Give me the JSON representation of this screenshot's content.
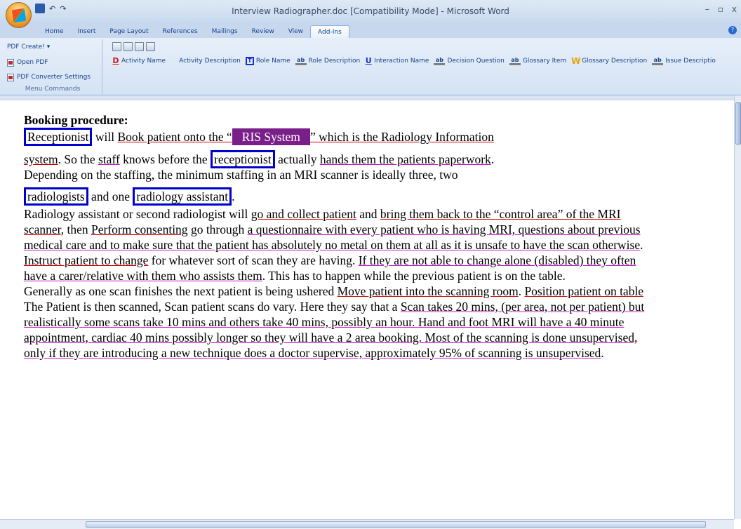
{
  "window": {
    "title": "Interview Radiographer.doc [Compatibility Mode] - Microsoft Word",
    "minimize": "–",
    "restore": "▫",
    "close": "x",
    "undo_glyph": "↶",
    "redo_glyph": "↷"
  },
  "tabs": [
    "Home",
    "Insert",
    "Page Layout",
    "References",
    "Mailings",
    "Review",
    "View",
    "Add-Ins"
  ],
  "active_tab": "Add-Ins",
  "menu_commands": {
    "pdf_create": "PDF Create! ▾",
    "open_pdf": "Open PDF",
    "converter_settings": "PDF Converter Settings",
    "group_label": "Menu Commands"
  },
  "custom_toolbar": [
    {
      "icon": "D",
      "label": "Activity Name"
    },
    {
      "icon": "",
      "label": "Activity Description"
    },
    {
      "icon": "T",
      "label": "Role Name"
    },
    {
      "icon": "ab",
      "label": "Role Description"
    },
    {
      "icon": "U",
      "label": "Interaction Name"
    },
    {
      "icon": "ab",
      "label": "Decision Question"
    },
    {
      "icon": "ab",
      "label": "Glossary Item"
    },
    {
      "icon": "W",
      "label": "Glossary Description"
    },
    {
      "icon": "ab",
      "label": "Issue Descriptio"
    }
  ],
  "doc": {
    "heading": "Booking procedure:",
    "p1_a": "Receptionist",
    "p1_b": " will ",
    "p1_c": "Book patient onto the “",
    "p1_d": "RIS System",
    "p1_e": "” which is the Radiology Information",
    "p2_a": "system",
    "p2_b": ". So the ",
    "p2_c": "staff",
    "p2_d": " knows before the ",
    "p2_e": "receptionist",
    "p2_f": " actually ",
    "p2_g": "hands them the patients paperwork",
    "p2_h": ".",
    "p3": "Depending on the staffing, the minimum staffing in an MRI scanner is ideally three, two",
    "p4_a": "radiologists",
    "p4_b": " and one ",
    "p4_c": "radiology assistant",
    "p4_d": ".",
    "p5_a": "Radiology assistant or second radiologist will ",
    "p5_b": "go and collect patient",
    "p5_c": " and ",
    "p5_d": "bring them back to the “control area” of the MRI scanner",
    "p5_e": ", then ",
    "p5_f": "Perform consenting",
    "p5_g": " go through ",
    "p5_h": "a questionnaire with every patient who is having MRI, questions about previous medical care and to make sure that the patient has absolutely no metal on them at all as it is unsafe to have the scan otherwise",
    "p5_i": ". ",
    "p5_j": "Instruct patient to change",
    "p5_k": " for whatever sort of scan they are having. ",
    "p5_l": "If they are not able to change alone (disabled) they often have a carer/relative with them who assists them",
    "p5_m": ". This has to happen while the previous patient is on the table.",
    "p6_a": "Generally as one scan finishes the next patient is being ushered ",
    "p6_b": "Move patient into the scanning room",
    "p6_c": ". ",
    "p6_d": "Position patient on table",
    "p7_a": "The Patient is then scanned, Scan patient scans do vary. Here they say that a ",
    "p7_b": "Scan takes 20 mins, (per area, not per patient) but realistically some scans take 10 mins and others take 40 mins, possibly an hour.  Hand and foot MRI will have a 40 minute appointment, cardiac 40 mins possibly longer so they will have a 2 area booking. Most of the scanning is done unsupervised, only if they are introducing a new technique does a doctor supervise, approximately 95% of scanning is unsupervised",
    "p7_c": "."
  },
  "colors": {
    "box": "#0000cc",
    "ris_bg": "#7a1f8a",
    "underline_red": "#cc0000",
    "underline_magenta": "#c818c8"
  }
}
